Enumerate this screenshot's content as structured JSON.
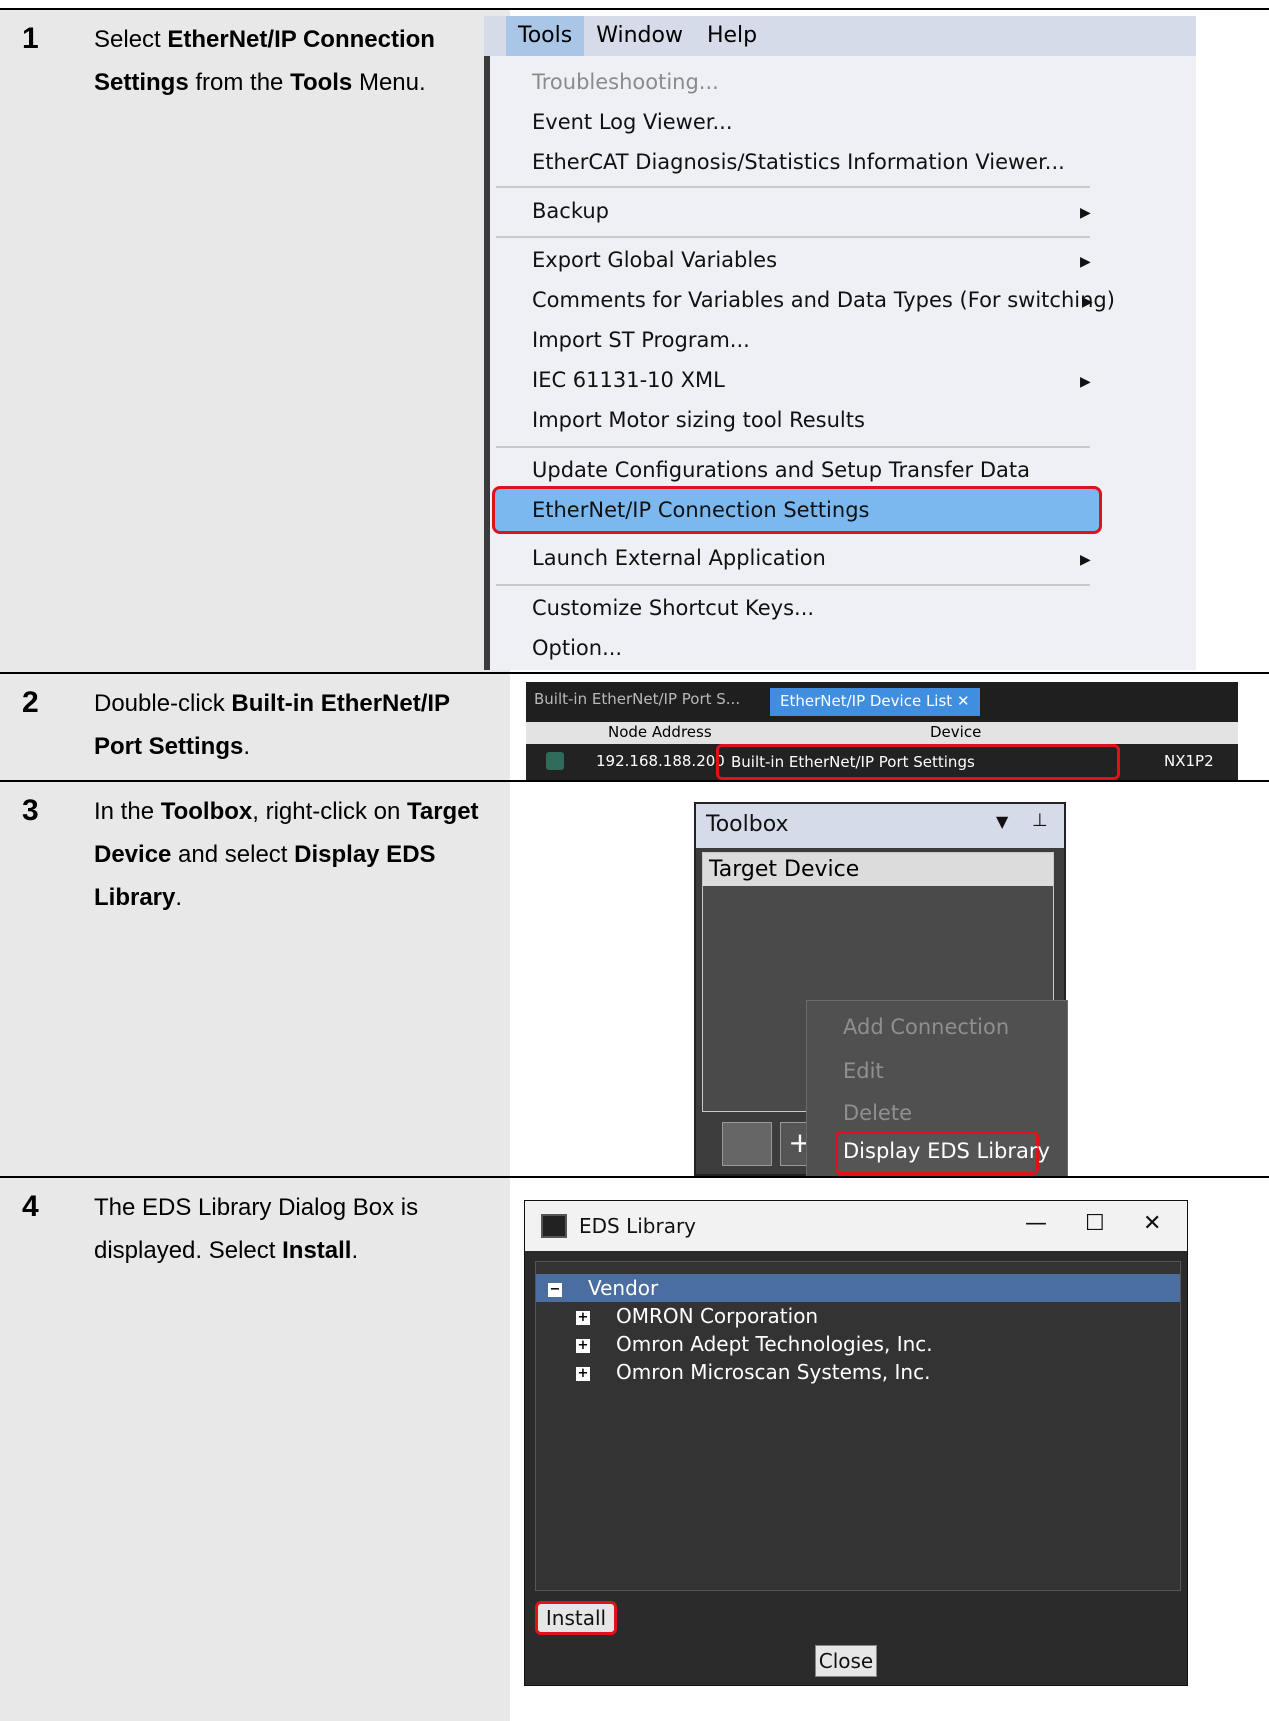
{
  "steps": [
    {
      "number": "1",
      "parts": [
        {
          "t": "Select ",
          "b": false
        },
        {
          "t": "EtherNet/IP Connection Settings",
          "b": true
        },
        {
          "t": " from the ",
          "b": false
        },
        {
          "t": "Tools",
          "b": true
        },
        {
          "t": " Menu.",
          "b": false
        }
      ]
    },
    {
      "number": "2",
      "parts": [
        {
          "t": "Double-click ",
          "b": false
        },
        {
          "t": "Built-in EtherNet/IP Port Settings",
          "b": true
        },
        {
          "t": ".",
          "b": false
        }
      ]
    },
    {
      "number": "3",
      "parts": [
        {
          "t": "In the ",
          "b": false
        },
        {
          "t": "Toolbox",
          "b": true
        },
        {
          "t": ", right-click on ",
          "b": false
        },
        {
          "t": "Target Device",
          "b": true
        },
        {
          "t": " and select ",
          "b": false
        },
        {
          "t": "Display EDS Library",
          "b": true
        },
        {
          "t": ".",
          "b": false
        }
      ]
    },
    {
      "number": "4",
      "parts": [
        {
          "t": "The EDS Library Dialog Box is displayed. Select ",
          "b": false
        },
        {
          "t": "Install",
          "b": true
        },
        {
          "t": ".",
          "b": false
        }
      ]
    }
  ],
  "menu": {
    "bar": [
      "Tools",
      "Window",
      "Help"
    ],
    "items": {
      "troubleshooting": "Troubleshooting...",
      "event_log": "Event Log Viewer...",
      "ethercat": "EtherCAT Diagnosis/Statistics Information Viewer...",
      "backup": "Backup",
      "export_vars": "Export Global Variables",
      "comments": "Comments for Variables and Data Types (For switching)",
      "import_st": "Import ST Program...",
      "iec": "IEC 61131-10 XML",
      "motor": "Import Motor sizing tool Results",
      "update": "Update Configurations and Setup Transfer Data",
      "eip": "EtherNet/IP Connection Settings",
      "launch": "Launch External Application",
      "shortcut": "Customize Shortcut Keys...",
      "option": "Option..."
    }
  },
  "devicelist": {
    "tab1": "Built-in EtherNet/IP Port S...",
    "tab2": "EtherNet/IP Device List",
    "col_node": "Node Address",
    "col_device": "Device",
    "row_ip": "192.168.188.200",
    "row_device": "Built-in EtherNet/IP Port Settings",
    "row_model": "NX1P2"
  },
  "toolbox": {
    "title": "Toolbox",
    "target": "Target Device",
    "ctx": [
      "Add Connection",
      "Edit",
      "Delete",
      "Display EDS Library"
    ]
  },
  "eds": {
    "title": "EDS Library",
    "root": "Vendor",
    "vendors": [
      "OMRON Corporation",
      "Omron Adept Technologies, Inc.",
      "Omron Microscan Systems, Inc."
    ],
    "install": "Install",
    "close": "Close"
  }
}
